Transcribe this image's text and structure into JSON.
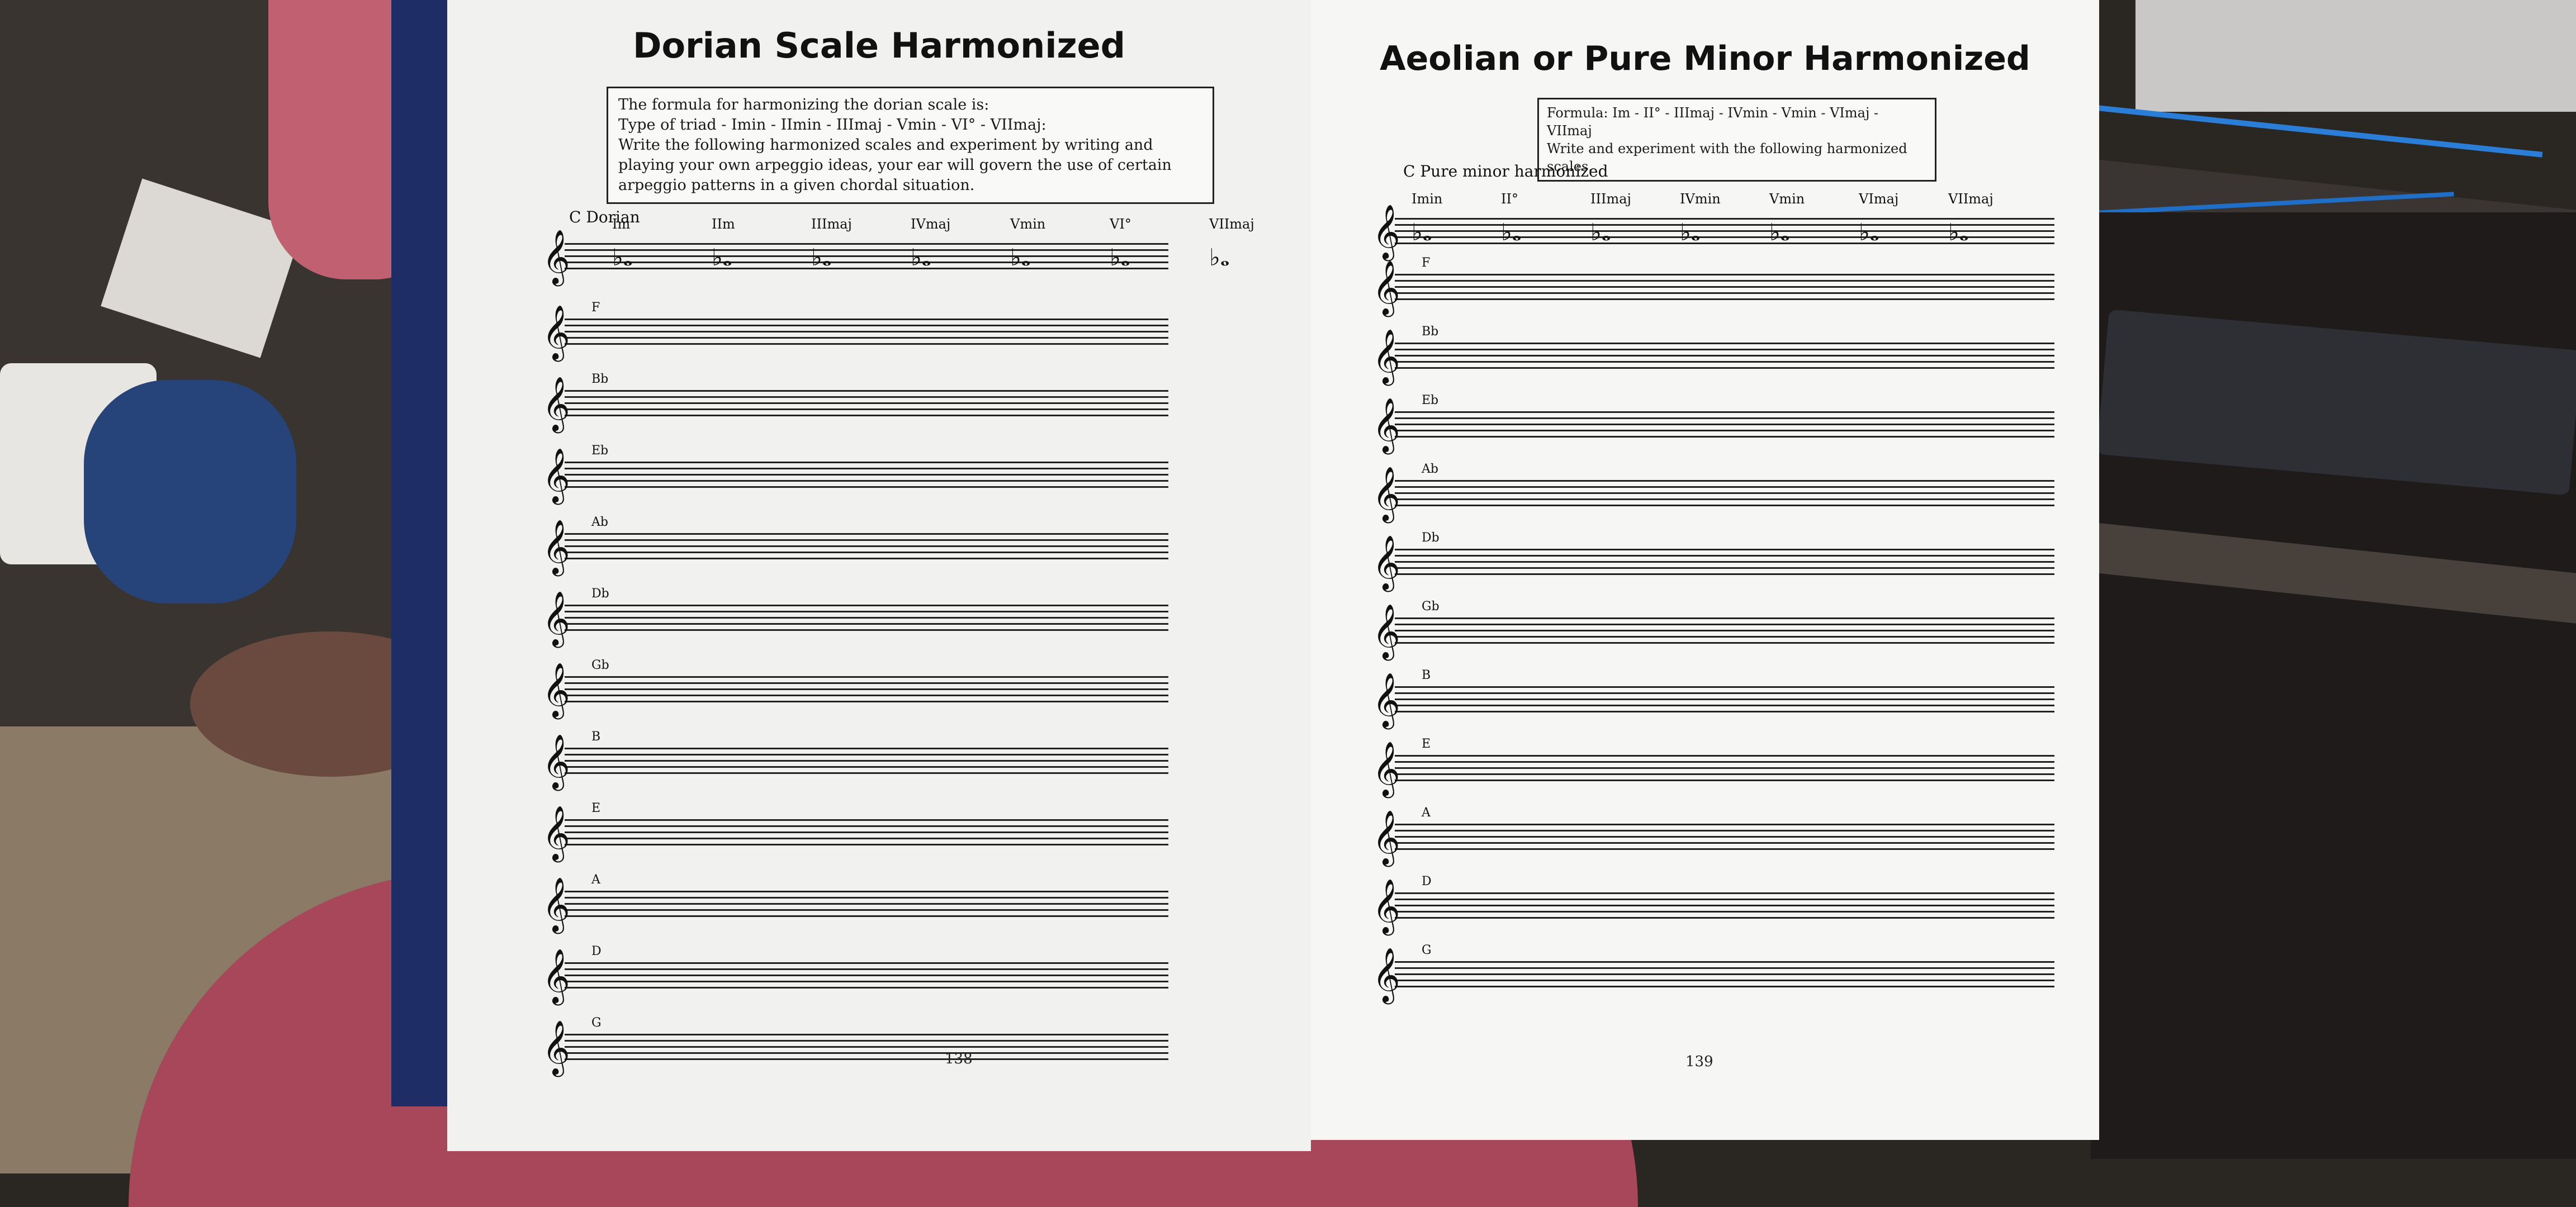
{
  "left_page": {
    "title": "Dorian Scale Harmonized",
    "formula": {
      "line1": "The formula for harmonizing the dorian scale is:",
      "line2": "Type of triad - Imin - IImin - IIImaj - Vmin - VI° - VIImaj:",
      "line3": "Write the following harmonized scales and experiment by writing and playing your own arpeggio ideas, your ear will govern the use of certain arpeggio patterns in a given chordal situation."
    },
    "example_label": "C Dorian",
    "degrees": [
      "Im",
      "IIm",
      "IIImaj",
      "IVmaj",
      "Vmin",
      "VI°",
      "VIImaj"
    ],
    "keys": [
      "F",
      "Bb",
      "Eb",
      "Ab",
      "Db",
      "Gb",
      "B",
      "E",
      "A",
      "D",
      "G"
    ],
    "page_number": "138"
  },
  "right_page": {
    "title": "Aeolian or Pure Minor Harmonized",
    "formula": {
      "line1": "Formula: Im - II° - IIImaj - IVmin - Vmin - VImaj - VIImaj",
      "line2": "Write and experiment with the following harmonized scales."
    },
    "example_label": "C Pure minor harmonized",
    "degrees": [
      "Imin",
      "II°",
      "IIImaj",
      "IVmin",
      "Vmin",
      "VImaj",
      "VIImaj"
    ],
    "keys": [
      "F",
      "Bb",
      "Eb",
      "Ab",
      "Db",
      "Gb",
      "B",
      "E",
      "A",
      "D",
      "G"
    ],
    "page_number": "139"
  },
  "icons": {
    "treble_clef": "𝄞",
    "chord_glyph": "♭𝅝"
  }
}
